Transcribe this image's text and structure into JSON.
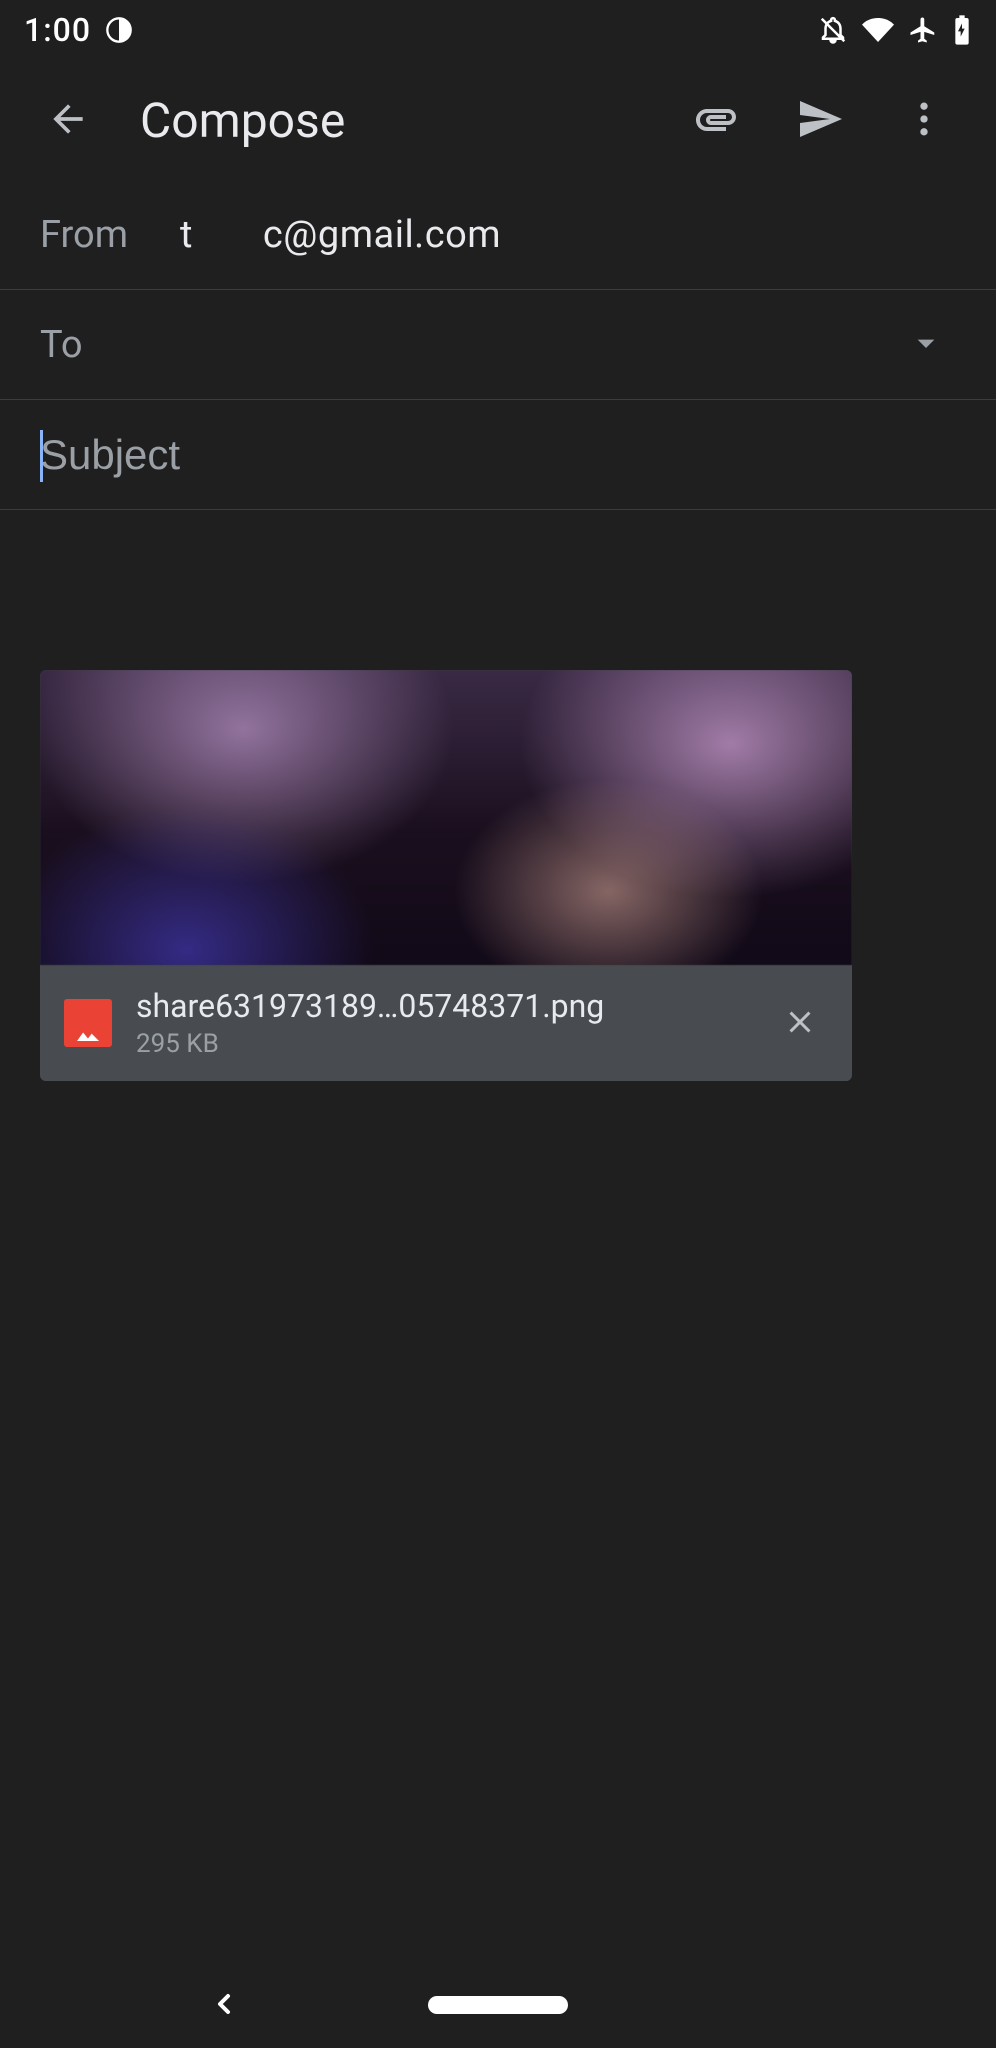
{
  "status": {
    "time": "1:00"
  },
  "appbar": {
    "title": "Compose"
  },
  "fields": {
    "from_label": "From",
    "from_value": "t c@gmail.com",
    "to_label": "To",
    "to_value": ""
  },
  "subject": {
    "placeholder": "Subject",
    "value": ""
  },
  "body": {
    "placeholder": "",
    "value": ""
  },
  "attachment": {
    "name": "share631973189…05748371.png",
    "size": "295 KB"
  }
}
